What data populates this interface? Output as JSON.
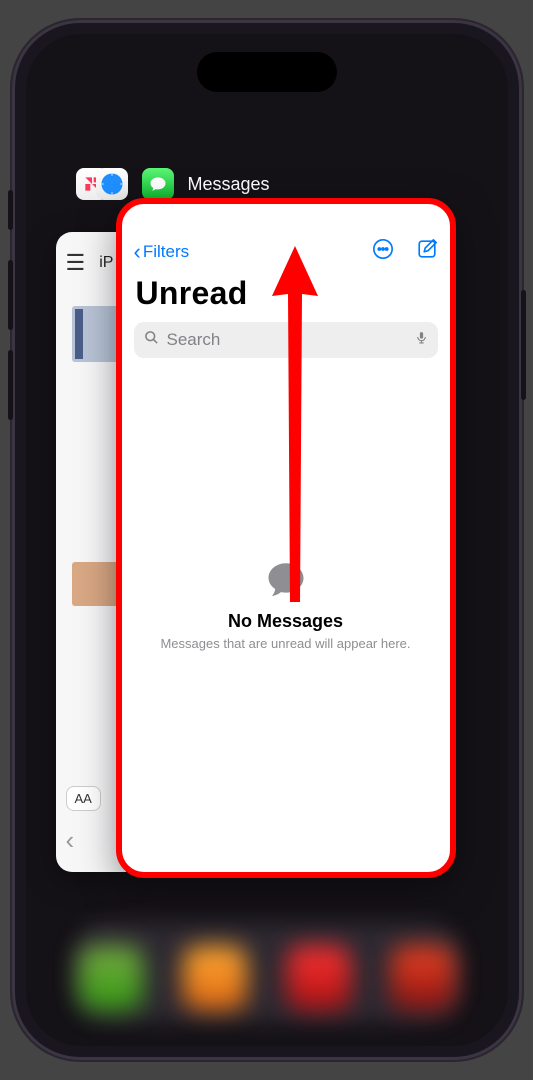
{
  "switcher": {
    "app_label": "Messages"
  },
  "bg_card": {
    "crumb": "iP",
    "text_size_label": "AA"
  },
  "messages": {
    "back_label": "Filters",
    "title": "Unread",
    "search_placeholder": "Search",
    "empty_title": "No Messages",
    "empty_subtitle": "Messages that are unread will appear here."
  }
}
